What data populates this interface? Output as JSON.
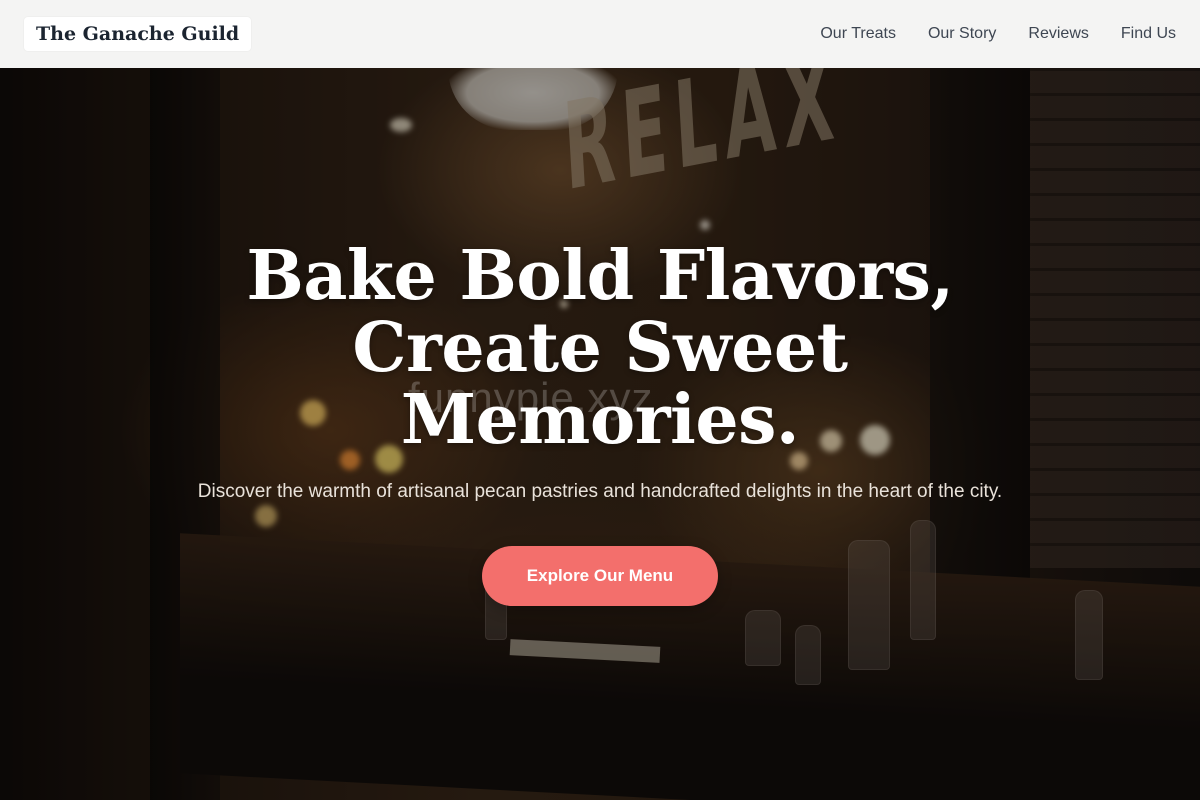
{
  "nav": {
    "brand": "The Ganache Guild",
    "links": [
      "Our Treats",
      "Our Story",
      "Reviews",
      "Find Us"
    ]
  },
  "hero": {
    "headline": "Bake Bold Flavors, Create Sweet Memories.",
    "tagline": "Discover the warmth of artisanal pecan pastries and handcrafted delights in the heart of the city.",
    "cta_label": "Explore Our Menu",
    "watermark": "funnypie.xyz"
  },
  "colors": {
    "nav_background": "#f4f4f3",
    "nav_text": "#3e4652",
    "brand_text": "#1b2430",
    "headline_text": "#ffffff",
    "cta_background": "#f36f6c",
    "cta_text": "#ffffff"
  }
}
